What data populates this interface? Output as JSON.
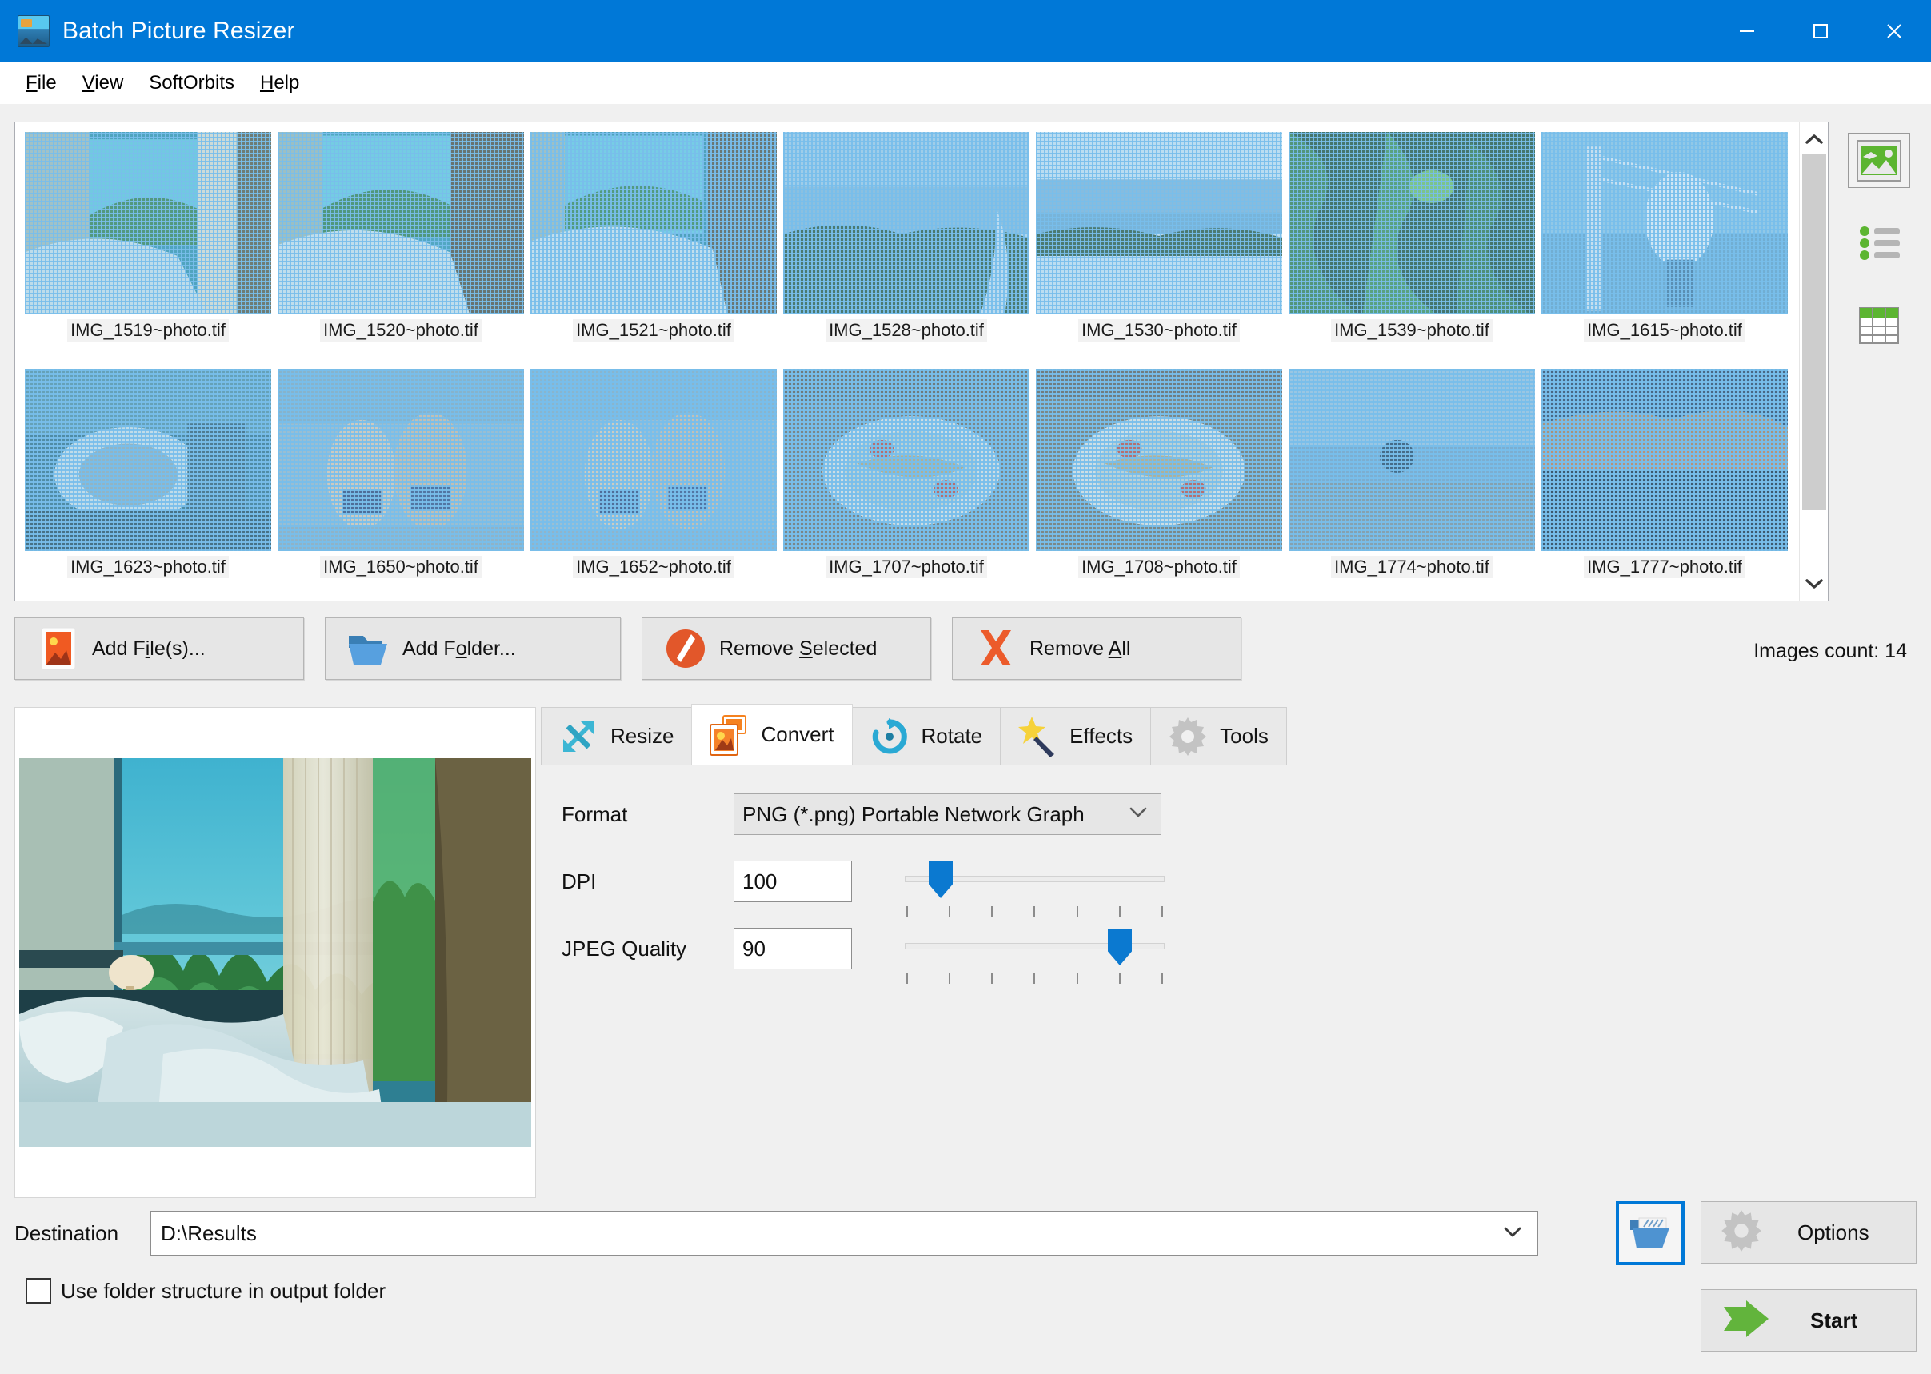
{
  "window": {
    "title": "Batch Picture Resizer",
    "app_icon": "picture-resizer-icon",
    "controls": {
      "minimize": "minimize-icon",
      "maximize": "maximize-icon",
      "close": "close-icon"
    }
  },
  "menu": [
    {
      "label": "File",
      "accel": "F"
    },
    {
      "label": "View",
      "accel": "V"
    },
    {
      "label": "SoftOrbits",
      "accel": ""
    },
    {
      "label": "Help",
      "accel": "H"
    }
  ],
  "thumbnails": {
    "rows": [
      [
        {
          "filename": "IMG_1519~photo.tif",
          "selected": true
        },
        {
          "filename": "IMG_1520~photo.tif",
          "selected": true
        },
        {
          "filename": "IMG_1521~photo.tif",
          "selected": true
        },
        {
          "filename": "IMG_1528~photo.tif",
          "selected": true
        },
        {
          "filename": "IMG_1530~photo.tif",
          "selected": true
        },
        {
          "filename": "IMG_1539~photo.tif",
          "selected": true
        },
        {
          "filename": "IMG_1615~photo.tif",
          "selected": true
        }
      ],
      [
        {
          "filename": "IMG_1623~photo.tif",
          "selected": true
        },
        {
          "filename": "IMG_1650~photo.tif",
          "selected": true
        },
        {
          "filename": "IMG_1652~photo.tif",
          "selected": true
        },
        {
          "filename": "IMG_1707~photo.tif",
          "selected": true
        },
        {
          "filename": "IMG_1708~photo.tif",
          "selected": true
        },
        {
          "filename": "IMG_1774~photo.tif",
          "selected": true
        },
        {
          "filename": "IMG_1777~photo.tif",
          "selected": true
        }
      ]
    ]
  },
  "view_modes": [
    {
      "name": "thumbnails-view",
      "icon": "image-icon",
      "selected": true
    },
    {
      "name": "list-view",
      "icon": "list-icon",
      "selected": false
    },
    {
      "name": "details-view",
      "icon": "table-icon",
      "selected": false
    }
  ],
  "actions": {
    "add_files": {
      "label_pre": "Add F",
      "label_accel": "i",
      "label_post": "le(s)...",
      "icon": "add-photo-icon"
    },
    "add_folder": {
      "label_pre": "Add F",
      "label_accel": "o",
      "label_post": "lder...",
      "icon": "folder-icon"
    },
    "remove_selected": {
      "label_pre": "Remove ",
      "label_accel": "S",
      "label_post": "elected",
      "icon": "no-entry-icon"
    },
    "remove_all": {
      "label_pre": "Remove ",
      "label_accel": "A",
      "label_post": "ll",
      "icon": "red-x-icon"
    },
    "images_count": "Images count: 14"
  },
  "tabs": [
    {
      "label": "Resize",
      "icon": "resize-arrow-icon",
      "active": false
    },
    {
      "label": "Convert",
      "icon": "convert-images-icon",
      "active": true
    },
    {
      "label": "Rotate",
      "icon": "rotate-arrow-icon",
      "active": false
    },
    {
      "label": "Effects",
      "icon": "magic-wand-icon",
      "active": false
    },
    {
      "label": "Tools",
      "icon": "gear-icon",
      "active": false
    }
  ],
  "convert_panel": {
    "format_label": "Format",
    "format_value": "PNG (*.png) Portable Network Graph",
    "dpi_label": "DPI",
    "dpi_value": "100",
    "dpi_slider_percent": 10,
    "jpeg_label": "JPEG Quality",
    "jpeg_value": "90",
    "jpeg_slider_percent": 86
  },
  "destination": {
    "label": "Destination",
    "value": "D:\\Results",
    "browse_icon": "open-folder-icon"
  },
  "use_folder_structure": {
    "label": "Use folder structure in output folder",
    "checked": false
  },
  "buttons": {
    "options": {
      "label": "Options",
      "icon": "gear-icon"
    },
    "start": {
      "label": "Start",
      "icon": "green-arrow-icon"
    }
  },
  "colors": {
    "title_bar": "#0078d7",
    "accent_blue": "#0b79d0",
    "start_green": "#62b43c",
    "selection_blue": "#78bee8",
    "window_bg": "#f0f0f0"
  }
}
